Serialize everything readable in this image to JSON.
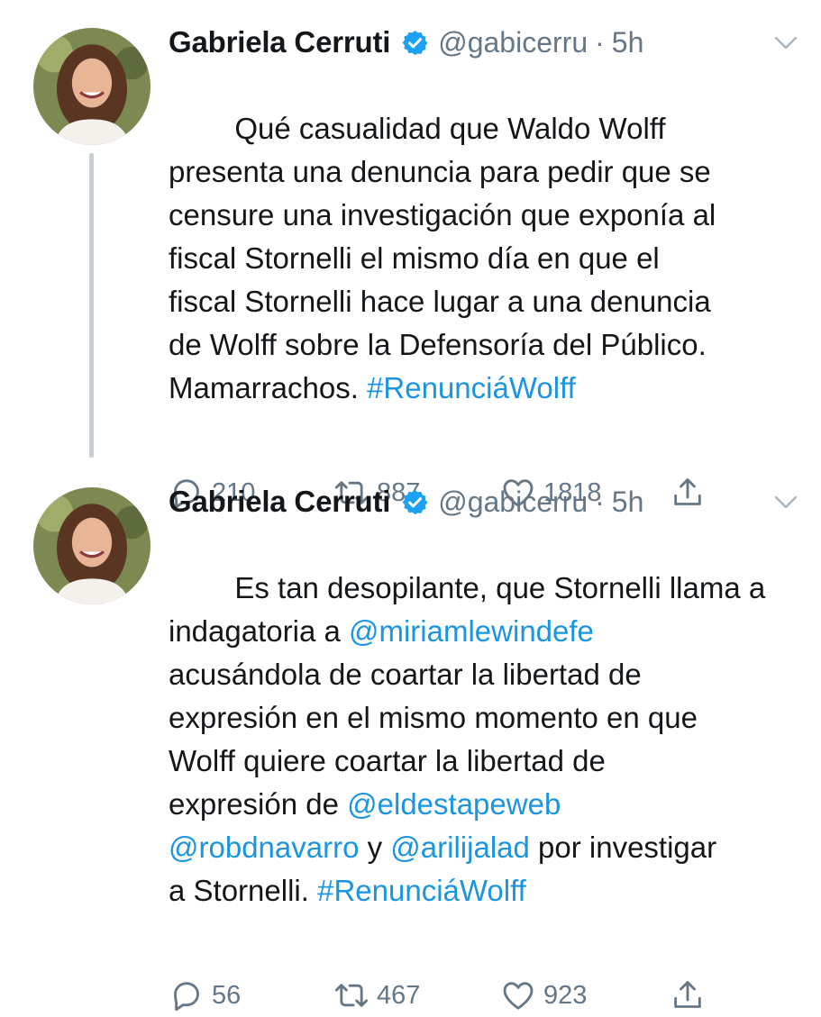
{
  "colors": {
    "link": "#1b95e0",
    "muted": "#657786",
    "verified": "#1da1f2",
    "thread_line": "#c4cfd6"
  },
  "tweets": [
    {
      "name": "Gabriela Cerruti",
      "handle": "@gabicerru",
      "separator": "·",
      "time": "5h",
      "body": [
        {
          "text": "Qué casualidad que Waldo Wolff\npresenta una denuncia para pedir que se\ncensure una investigación que exponía al\nfiscal Stornelli el mismo día en que el\nfiscal Stornelli hace lugar a una denuncia\nde Wolff sobre la Defensoría del Público.\nMamarrachos. "
        },
        {
          "text": "#RenunciáWolff",
          "link": true
        }
      ],
      "replies": "210",
      "retweets": "887",
      "likes": "1818"
    },
    {
      "name": "Gabriela Cerruti",
      "handle": "@gabicerru",
      "separator": "·",
      "time": "5h",
      "body": [
        {
          "text": "Es tan desopilante, que Stornelli llama a\nindagatoria a "
        },
        {
          "text": "@miriamlewindefe",
          "link": true
        },
        {
          "text": "\nacusándola de coartar la libertad de\nexpresión en el mismo momento en que\nWolff quiere coartar la libertad de\nexpresión de "
        },
        {
          "text": "@eldestapeweb",
          "link": true
        },
        {
          "text": "\n"
        },
        {
          "text": "@robdnavarro",
          "link": true
        },
        {
          "text": " y "
        },
        {
          "text": "@arilijalad",
          "link": true
        },
        {
          "text": " por investigar\na Stornelli. "
        },
        {
          "text": "#RenunciáWolff",
          "link": true
        }
      ],
      "replies": "56",
      "retweets": "467",
      "likes": "923"
    }
  ]
}
